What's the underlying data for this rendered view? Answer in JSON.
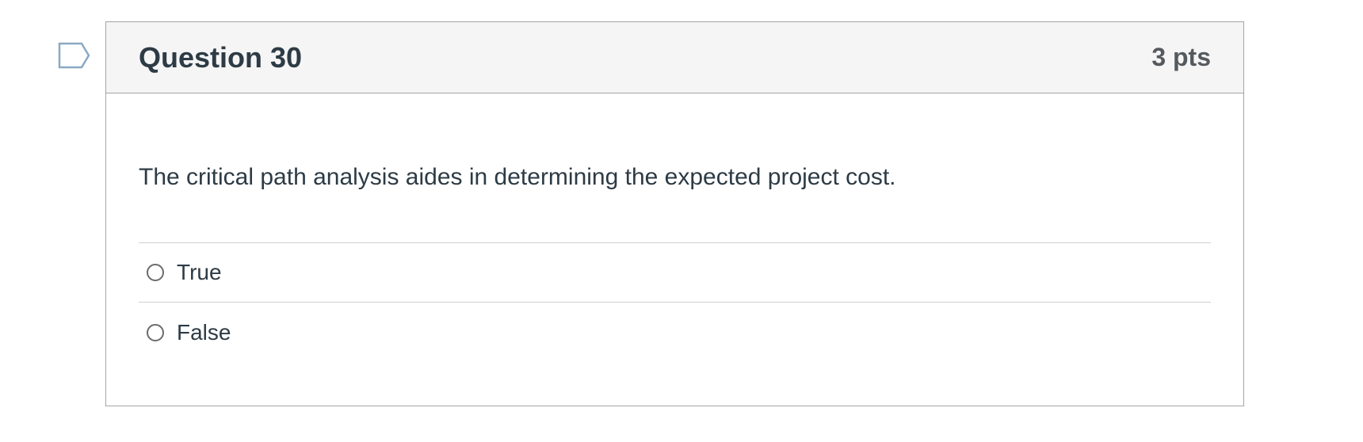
{
  "question": {
    "title": "Question 30",
    "points": "3 pts",
    "flag_icon": "flag-outline-icon",
    "text": "The critical path analysis aides in determining the expected project cost.",
    "answers": [
      {
        "label": "True",
        "selected": false
      },
      {
        "label": "False",
        "selected": false
      }
    ]
  },
  "colors": {
    "header_bg": "#f5f5f5",
    "border": "#a5a5a5",
    "text": "#2d3b45",
    "flag_stroke": "#8aa9c4"
  }
}
